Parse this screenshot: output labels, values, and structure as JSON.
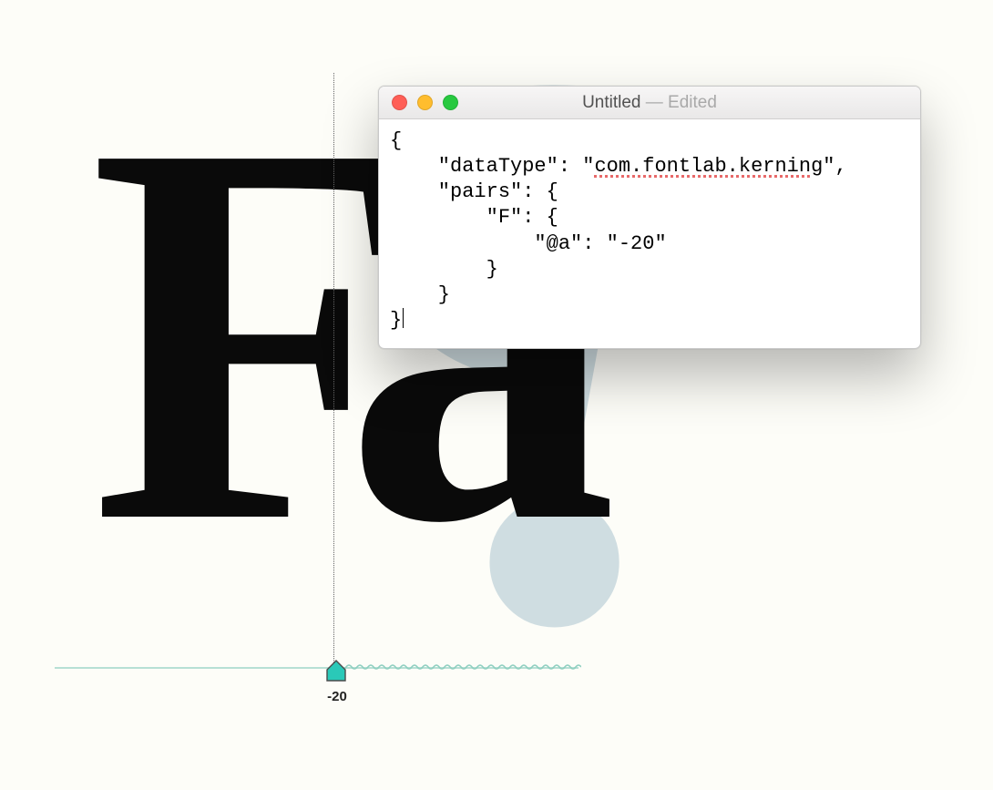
{
  "background": {
    "watermark_glyph": "?"
  },
  "kerning_preview": {
    "left_glyph": "F",
    "right_glyph": "a",
    "kern_value": "-20"
  },
  "editor": {
    "window_title": "Untitled",
    "window_status": "Edited",
    "code_lines": {
      "l1": "{",
      "l2a": "    \"dataType\": \"",
      "l2b": "com.fontlab.kerning",
      "l2c": "\",",
      "l3": "    \"pairs\": {",
      "l4": "        \"F\": {",
      "l5": "            \"@a\": \"-20\"",
      "l6": "        }",
      "l7": "    }",
      "l8": "}"
    },
    "json_data": {
      "dataType": "com.fontlab.kerning",
      "pairs": {
        "F": {
          "@a": "-20"
        }
      }
    }
  }
}
